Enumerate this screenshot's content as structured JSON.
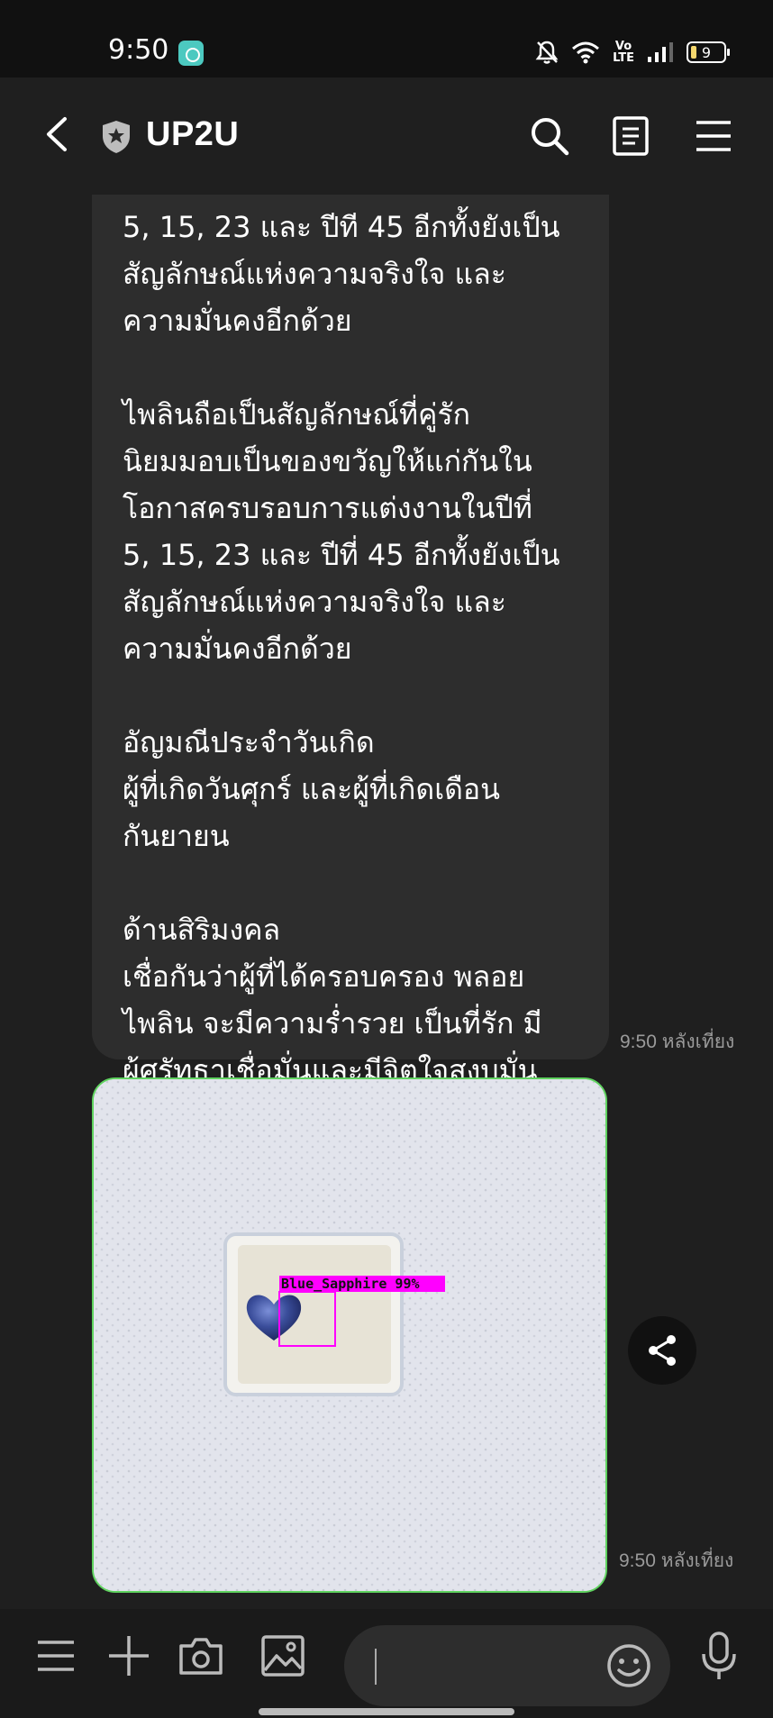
{
  "status_bar": {
    "time": "9:50",
    "volte_top": "Vo",
    "volte_bottom": "LTE",
    "battery_level": "9",
    "icons": [
      "app-notification-icon",
      "mute-bell-icon",
      "wifi-icon",
      "volte-icon",
      "signal-icon",
      "battery-icon"
    ]
  },
  "header": {
    "title": "UP2U",
    "icons": [
      "back-arrow-icon",
      "shield-icon",
      "search-icon",
      "notes-icon",
      "menu-icon"
    ]
  },
  "messages": [
    {
      "type": "text",
      "text": "5, 15, 23 และ ปีที 45 อีกทั้งยังเป็น\nสัญลักษณ์แห่งความจริงใจ และ\nความมั่นคงอีกด้วย\n\nไพลินถือเป็นสัญลักษณ์ที่คู่รัก\nนิยมมอบเป็นของขวัญให้แก่กันใน\nโอกาสครบรอบการแต่งงานในปีที่\n5, 15, 23 และ ปีที่ 45 อีกทั้งยังเป็น\nสัญลักษณ์แห่งความจริงใจ และ\nความมั่นคงอีกด้วย\n\nอัญมณีประจำวันเกิด\nผู้ที่เกิดวันศุกร์ และผู้ที่เกิดเดือน\nกันยายน\n\nด้านสิริมงคล\nเชื่อกันว่าผู้ที่ได้ครอบครอง พลอย\nไพลิน จะมีความร่ำรวย เป็นที่รัก มี\nผู้ศรัทธาเชื่อมั่นและมีจิตใจสงบมั่น\nในความดีงาม",
      "time": "9:50 หลังเที่ยง"
    },
    {
      "type": "image",
      "detection_label": "Blue_Sapphire 99%",
      "time": "9:50 หลังเที่ยง"
    }
  ],
  "input_bar": {
    "placeholder": "",
    "icons": [
      "menu-icon",
      "plus-icon",
      "camera-icon",
      "gallery-icon",
      "emoji-icon",
      "microphone-icon"
    ]
  },
  "colors": {
    "background": "#1f1f1f",
    "bubble": "#2d2d2d",
    "detection_box": "#ff00ff",
    "image_border": "#5fd35f"
  }
}
